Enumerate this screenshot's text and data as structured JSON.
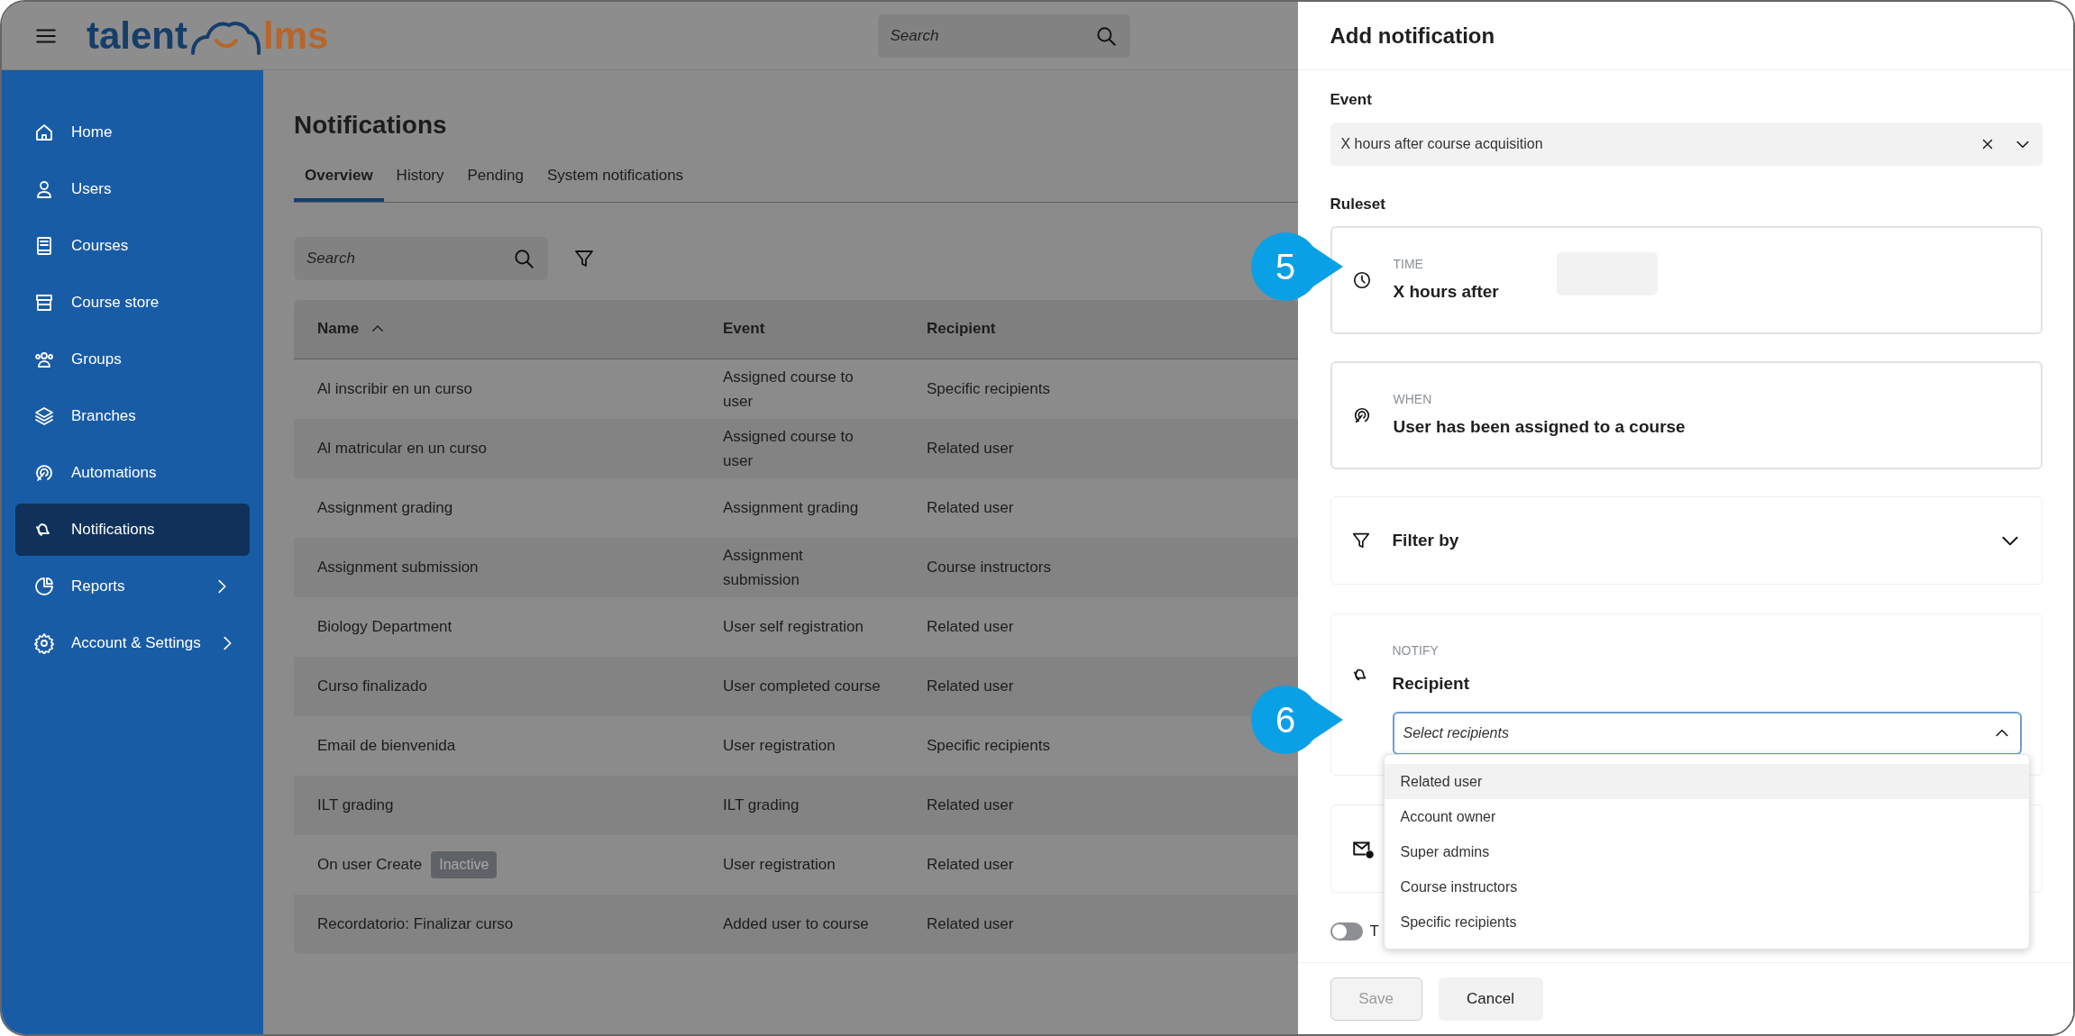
{
  "header": {
    "logo": {
      "first": "talent",
      "second": "lms"
    },
    "search": {
      "placeholder": "Search"
    }
  },
  "sidebar": {
    "items": [
      {
        "label": "Home",
        "selected": false,
        "submenu": false
      },
      {
        "label": "Users",
        "selected": false,
        "submenu": false
      },
      {
        "label": "Courses",
        "selected": false,
        "submenu": false
      },
      {
        "label": "Course store",
        "selected": false,
        "submenu": false
      },
      {
        "label": "Groups",
        "selected": false,
        "submenu": false
      },
      {
        "label": "Branches",
        "selected": false,
        "submenu": false
      },
      {
        "label": "Automations",
        "selected": false,
        "submenu": false
      },
      {
        "label": "Notifications",
        "selected": true,
        "submenu": false
      },
      {
        "label": "Reports",
        "selected": false,
        "submenu": true
      },
      {
        "label": "Account & Settings",
        "selected": false,
        "submenu": true
      }
    ]
  },
  "page": {
    "title": "Notifications",
    "tabs": [
      {
        "label": "Overview",
        "selected": true
      },
      {
        "label": "History",
        "selected": false
      },
      {
        "label": "Pending",
        "selected": false
      },
      {
        "label": "System notifications",
        "selected": false
      }
    ],
    "search": {
      "placeholder": "Search"
    },
    "table": {
      "columns": [
        {
          "label": "Name",
          "sorted": true
        },
        {
          "label": "Event",
          "sorted": false
        },
        {
          "label": "Recipient",
          "sorted": false
        }
      ],
      "rows": [
        {
          "name": "Al inscribir en un curso",
          "event": "Assigned course to user",
          "recipient": "Specific recipients"
        },
        {
          "name": "Al matricular en un curso",
          "event": "Assigned course to user",
          "recipient": "Related user"
        },
        {
          "name": "Assignment grading",
          "event": "Assignment grading",
          "recipient": "Related user"
        },
        {
          "name": "Assignment submission",
          "event": "Assignment submission",
          "recipient": "Course instructors"
        },
        {
          "name": "Biology Department",
          "event": "User self registration",
          "recipient": "Related user"
        },
        {
          "name": "Curso finalizado",
          "event": "User completed course",
          "recipient": "Related user"
        },
        {
          "name": "Email de bienvenida",
          "event": "User registration",
          "recipient": "Specific recipients"
        },
        {
          "name": "ILT grading",
          "event": "ILT grading",
          "recipient": "Related user"
        },
        {
          "name": "On user Create",
          "badge": "Inactive",
          "event": "User registration",
          "recipient": "Related user"
        },
        {
          "name": "Recordatorio: Finalizar curso",
          "event": "Added user to course",
          "recipient": "Related user"
        }
      ]
    }
  },
  "panel": {
    "title": "Add notification",
    "event": {
      "label": "Event",
      "value": "X hours after course acquisition"
    },
    "ruleset_label": "Ruleset",
    "time": {
      "caption": "TIME",
      "title": "X hours after"
    },
    "when": {
      "caption": "WHEN",
      "title": "User has been assigned to a course"
    },
    "filter": {
      "title": "Filter by",
      "expanded": false
    },
    "notify": {
      "caption": "NOTIFY",
      "title": "Recipient",
      "select": {
        "placeholder": "Select recipients",
        "expanded": true,
        "options": [
          {
            "label": "Related user",
            "selected": true
          },
          {
            "label": "Account owner",
            "selected": false
          },
          {
            "label": "Super admins",
            "selected": false
          },
          {
            "label": "Course instructors",
            "selected": false
          },
          {
            "label": "Specific recipients",
            "selected": false
          }
        ]
      }
    },
    "toggle": {
      "label": "T",
      "on": false
    },
    "buttons": [
      {
        "label": "Save",
        "disabled": true
      },
      {
        "label": "Cancel",
        "disabled": false
      }
    ]
  },
  "callouts": [
    {
      "label": "5"
    },
    {
      "label": "6"
    }
  ]
}
